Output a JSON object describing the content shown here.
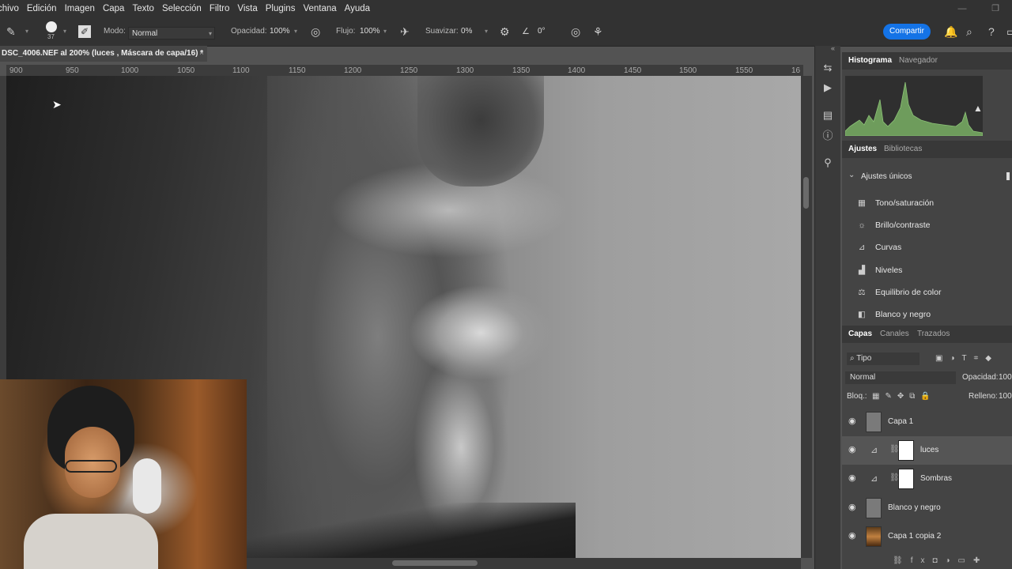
{
  "menu": [
    "chivo",
    "Edición",
    "Imagen",
    "Capa",
    "Texto",
    "Selección",
    "Filtro",
    "Vista",
    "Plugins",
    "Ventana",
    "Ayuda"
  ],
  "options": {
    "brush_size": "37",
    "mode_label": "Modo:",
    "mode_value": "Normal",
    "opacity_label": "Opacidad:",
    "opacity_value": "100%",
    "flow_label": "Flujo:",
    "flow_value": "100%",
    "smooth_label": "Suavizar:",
    "smooth_value": "0%",
    "angle_value": "0°",
    "share_label": "Compartir"
  },
  "document": {
    "tab_title": "DSC_4006.NEF al 200% (luces , Máscara de capa/16) *",
    "close": "×"
  },
  "ruler": [
    "900",
    "950",
    "1000",
    "1050",
    "1100",
    "1150",
    "1200",
    "1250",
    "1300",
    "1350",
    "1400",
    "1450",
    "1500",
    "1550",
    "16"
  ],
  "histogram_panel": {
    "tabs": [
      "Histograma",
      "Navegador"
    ],
    "warning_icon": "warning-triangle-icon"
  },
  "adjustments_panel": {
    "tabs": [
      "Ajustes",
      "Bibliotecas"
    ],
    "section": "Ajustes únicos",
    "items": [
      "Tono/saturación",
      "Brillo/contraste",
      "Curvas",
      "Niveles",
      "Equilibrio de color",
      "Blanco y negro"
    ]
  },
  "layers_panel": {
    "tabs": [
      "Capas",
      "Canales",
      "Trazados"
    ],
    "filter": "Tipo",
    "blend_mode": "Normal",
    "opacity_label": "Opacidad:",
    "opacity_value": "100",
    "lock_label": "Bloq.:",
    "fill_label": "Relleno:",
    "fill_value": "100",
    "layers": [
      {
        "name": "Capa 1",
        "type": "pixel",
        "selected": false
      },
      {
        "name": "luces",
        "type": "adjustment",
        "selected": true
      },
      {
        "name": "Sombras",
        "type": "adjustment",
        "selected": false
      },
      {
        "name": "Blanco y negro",
        "type": "pixel",
        "selected": false
      },
      {
        "name": "Capa 1 copia 2",
        "type": "photo",
        "selected": false
      }
    ]
  }
}
